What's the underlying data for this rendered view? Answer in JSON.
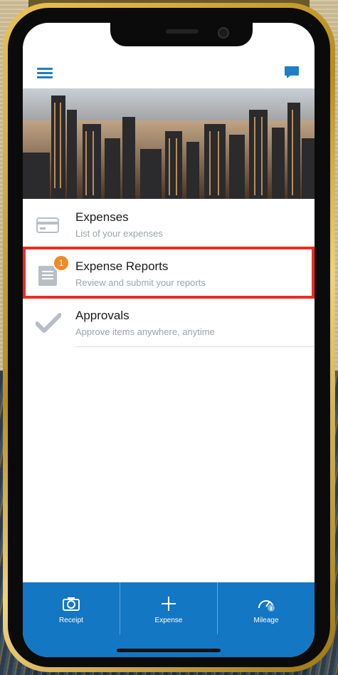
{
  "menu": {
    "items": [
      {
        "title": "Expenses",
        "subtitle": "List of your expenses",
        "icon": "credit-card-icon"
      },
      {
        "title": "Expense Reports",
        "subtitle": "Review and submit your reports",
        "icon": "document-icon",
        "badge": "1"
      },
      {
        "title": "Approvals",
        "subtitle": "Approve items anywhere, anytime",
        "icon": "checkmark-icon"
      }
    ]
  },
  "tabs": [
    {
      "label": "Receipt",
      "icon": "camera-icon"
    },
    {
      "label": "Expense",
      "icon": "plus-icon"
    },
    {
      "label": "Mileage",
      "icon": "speedometer-icon"
    }
  ],
  "colors": {
    "accent": "#1f7fc4",
    "tabbar": "#1377c3",
    "highlight": "#ee2b22",
    "badge": "#f08a24"
  }
}
